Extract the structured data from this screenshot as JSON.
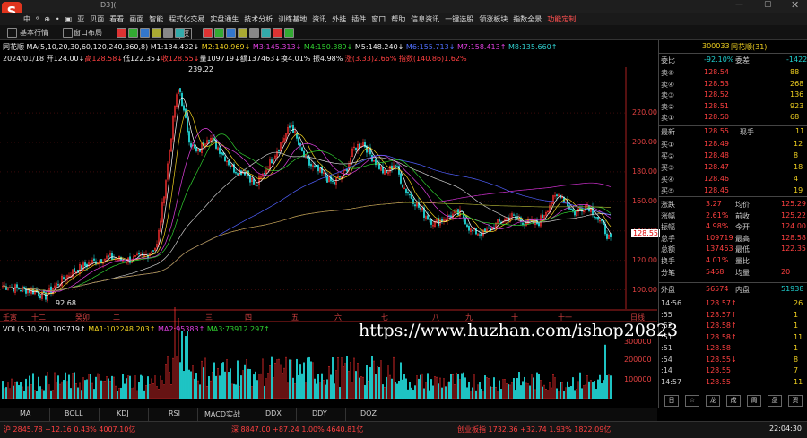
{
  "window": {
    "title": "D3](",
    "logo": "S"
  },
  "menu": [
    "中",
    "⁶ ",
    "⊕",
    "•",
    "▣",
    "亚",
    "贝面",
    "看看",
    "画面",
    "智能",
    "程式化交易",
    "实盘通生",
    "技术分析",
    "训练基地",
    "资讯",
    "外挂",
    "插件",
    "窗口",
    "帮助",
    "信息资讯",
    "一键选股",
    "领涨板块",
    "指数全景",
    "功能定制"
  ],
  "toolbar": {
    "items": [
      "基本行情",
      "窗口布局",
      "权"
    ]
  },
  "chart": {
    "header1": {
      "name": "同花顺",
      "ma_label": "MA(5,10,20,30,60,120,240,360,8)",
      "ma": [
        "M1:134.432↓",
        "M2:140.969↓",
        "M3:145.313↓",
        "M4:150.389↓",
        "M5:148.240↓",
        "M6:155.713↓",
        "M7:158.413↑",
        "M8:135.660↑"
      ]
    },
    "header2": {
      "date": "2024/01/18",
      "open": "开124.00↓",
      "high": "高128.58↓",
      "low": "低122.35↓",
      "close": "收128.55↓",
      "vol": "量109719↓",
      "amt": "额137463↓",
      "turnover": "换4.01%",
      "amp": "振4.98%",
      "chg": "涨(3.33)2.66%",
      "index": "指数(140.86)1.62%"
    },
    "price_labels": [
      "220.00",
      "200.00",
      "180.00",
      "160.00",
      "140.00",
      "120.00",
      "100.00"
    ],
    "current_price": "128.55",
    "peak_label": "239.22",
    "trough_label": "92.68",
    "time_labels": [
      "壬寅",
      "十二",
      "癸卯",
      "二",
      "三",
      "四",
      "五",
      "六",
      "七",
      "八",
      "九",
      "十",
      "十一",
      "日线"
    ],
    "vol_header": {
      "label": "VOL(5,10,20)",
      "v": "109719↑",
      "ma1": "MA1:102248.203↑",
      "ma2": "MA2:95383↑",
      "ma3": "MA3:73912.297↑"
    },
    "vol_labels": [
      "300000",
      "200000",
      "100000"
    ]
  },
  "right_panel": {
    "code": "300033",
    "name": "同花顺(31)",
    "weibi_label": "委比",
    "weibi": "-92.10%",
    "weicha_label": "委差",
    "weicha": "-1422",
    "asks": [
      {
        "label": "卖⑤",
        "price": "128.54",
        "vol": "88"
      },
      {
        "label": "卖④",
        "price": "128.53",
        "vol": "268"
      },
      {
        "label": "卖③",
        "price": "128.52",
        "vol": "136"
      },
      {
        "label": "卖②",
        "price": "128.51",
        "vol": "923"
      },
      {
        "label": "卖①",
        "price": "128.50",
        "vol": "68"
      }
    ],
    "latest_label": "最新",
    "latest": "128.55",
    "xianshou_label": "现手",
    "xianshou": "11",
    "bids": [
      {
        "label": "买①",
        "price": "128.49",
        "vol": "12"
      },
      {
        "label": "买②",
        "price": "128.48",
        "vol": "8"
      },
      {
        "label": "买③",
        "price": "128.47",
        "vol": "18"
      },
      {
        "label": "买④",
        "price": "128.46",
        "vol": "4"
      },
      {
        "label": "买⑤",
        "price": "128.45",
        "vol": "19"
      }
    ],
    "stats": [
      [
        "涨跌",
        "3.27",
        "均价",
        "125.29"
      ],
      [
        "涨幅",
        "2.61%",
        "前收",
        "125.22"
      ],
      [
        "振幅",
        "4.98%",
        "今开",
        "124.00"
      ],
      [
        "总手",
        "109719",
        "最高",
        "128.58"
      ],
      [
        "总额",
        "137463",
        "最低",
        "122.35"
      ],
      [
        "换手",
        "4.01%",
        "量比",
        ""
      ],
      [
        "分笔",
        "5468",
        "均量",
        "20"
      ]
    ],
    "waipan_label": "外盘",
    "waipan": "56574",
    "neipan_label": "内盘",
    "neipan": "51938",
    "ticks": [
      [
        "14:56",
        "128.57↑",
        "26"
      ],
      [
        ":55",
        "128.57↑",
        "1"
      ],
      [
        ":52",
        "128.58↑",
        "1"
      ],
      [
        ":51",
        "128.58↑",
        "11"
      ],
      [
        ":51",
        "128.58",
        "1"
      ],
      [
        ":54",
        "128.55↓",
        "8"
      ],
      [
        ":14",
        "128.55",
        "7"
      ],
      [
        "14:57",
        "128.55",
        "11"
      ]
    ],
    "bottom_icons": [
      "日",
      "☆",
      "龙",
      "成",
      "周",
      "盘",
      "资"
    ]
  },
  "bottom_tabs": [
    "MA",
    "BOLL",
    "KDJ",
    "RSI",
    "MACD实战",
    "DDX",
    "DDY",
    "DOZ"
  ],
  "status": {
    "sh": "沪 2845.78 +12.16 0.43% 4007.10亿",
    "sz": "深 8847.00 +87.24 1.00% 4640.81亿",
    "cy": "创业板指 1732.36 +32.74 1.93% 1822.09亿",
    "time": "22:04:30"
  },
  "watermark": "https://www.huzhan.com/ishop20823",
  "chart_data": {
    "type": "candlestick",
    "ylim": [
      90,
      245
    ],
    "peak": 239.22,
    "trough": 92.68,
    "last_close": 128.55,
    "yticks": [
      100,
      120,
      140,
      160,
      180,
      200,
      220
    ]
  }
}
